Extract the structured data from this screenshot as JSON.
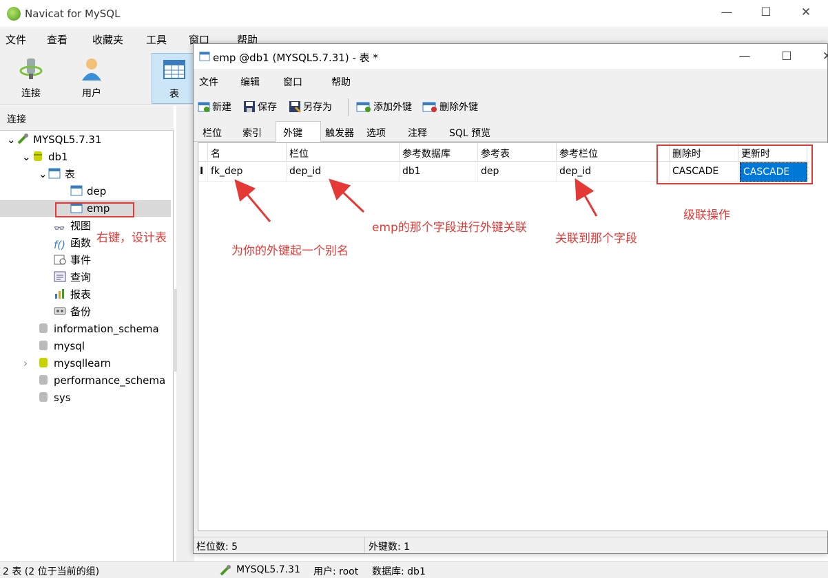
{
  "app": {
    "title": "Navicat for MySQL"
  },
  "menu": [
    "文件",
    "查看",
    "收藏夹",
    "工具",
    "窗口",
    "帮助"
  ],
  "toolbar": {
    "connect": "连接",
    "user": "用户",
    "table": "表"
  },
  "left": {
    "header": "连接",
    "connection": "MYSQL5.7.31",
    "db": "db1",
    "tables_node": "表",
    "table1": "dep",
    "table2": "emp",
    "views": "视图",
    "functions": "函数",
    "events": "事件",
    "queries": "查询",
    "reports": "报表",
    "backup": "备份",
    "db2": "information_schema",
    "db3": "mysql",
    "db4": "mysqllearn",
    "db5": "performance_schema",
    "db6": "sys"
  },
  "status": {
    "left": "2 表 (2 位于当前的组)",
    "conn": "MYSQL5.7.31",
    "user": "用户: root",
    "db": "数据库: db1"
  },
  "dialog": {
    "title": "emp @db1 (MYSQL5.7.31) - 表 *",
    "menu": [
      "文件",
      "编辑",
      "窗口",
      "帮助"
    ],
    "tb": {
      "new": "新建",
      "save": "保存",
      "saveas": "另存为",
      "addfk": "添加外键",
      "delfk": "删除外键"
    },
    "tabs": [
      "栏位",
      "索引",
      "外键",
      "触发器",
      "选项",
      "注释",
      "SQL 预览"
    ],
    "headers": [
      "名",
      "栏位",
      "参考数据库",
      "参考表",
      "参考栏位",
      "删除时",
      "更新时"
    ],
    "row": [
      "fk_dep",
      "dep_id",
      "db1",
      "dep",
      "dep_id",
      "CASCADE",
      "CASCADE"
    ],
    "status_fields": "栏位数: 5",
    "status_fk": "外键数: 1"
  },
  "annotations": {
    "rightclick": "右键，设计表",
    "alias": "为你的外键起一个别名",
    "field": "emp的那个字段进行外键关联",
    "reffield": "关联到那个字段",
    "cascade": "级联操作"
  },
  "colors": {
    "accent": "#0078d7",
    "annotation": "#e53935",
    "db_icon": "#c8d400"
  }
}
